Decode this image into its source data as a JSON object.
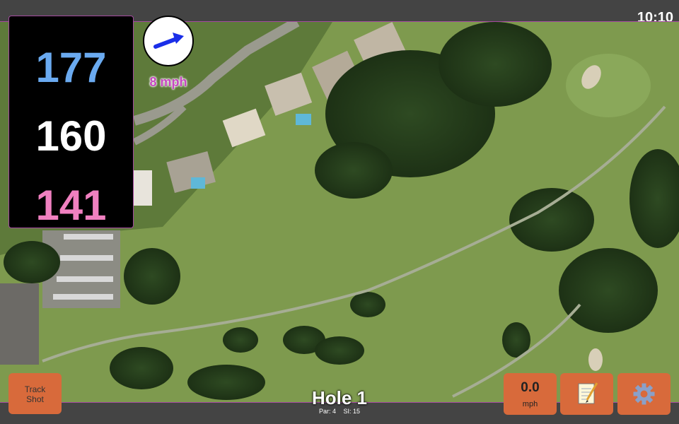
{
  "status_bar": {
    "time": "10:10"
  },
  "distances": {
    "back": "177",
    "middle": "160",
    "front": "141"
  },
  "wind": {
    "speed": "8 mph",
    "direction_icon": "arrow-up-right-icon"
  },
  "hole": {
    "title": "Hole 1",
    "par": "Par: 4",
    "stroke_index": "SI: 15"
  },
  "buttons": {
    "track_shot_line1": "Track",
    "track_shot_line2": "Shot",
    "speed_value": "0.0",
    "speed_unit": "mph",
    "notes_icon": "notepad-icon",
    "settings_icon": "gear-icon"
  },
  "colors": {
    "back_distance": "#6aaaf0",
    "middle_distance": "#ffffff",
    "front_distance": "#f080c0",
    "button_bg": "#d86a3b",
    "wind_text": "#c648c0"
  }
}
